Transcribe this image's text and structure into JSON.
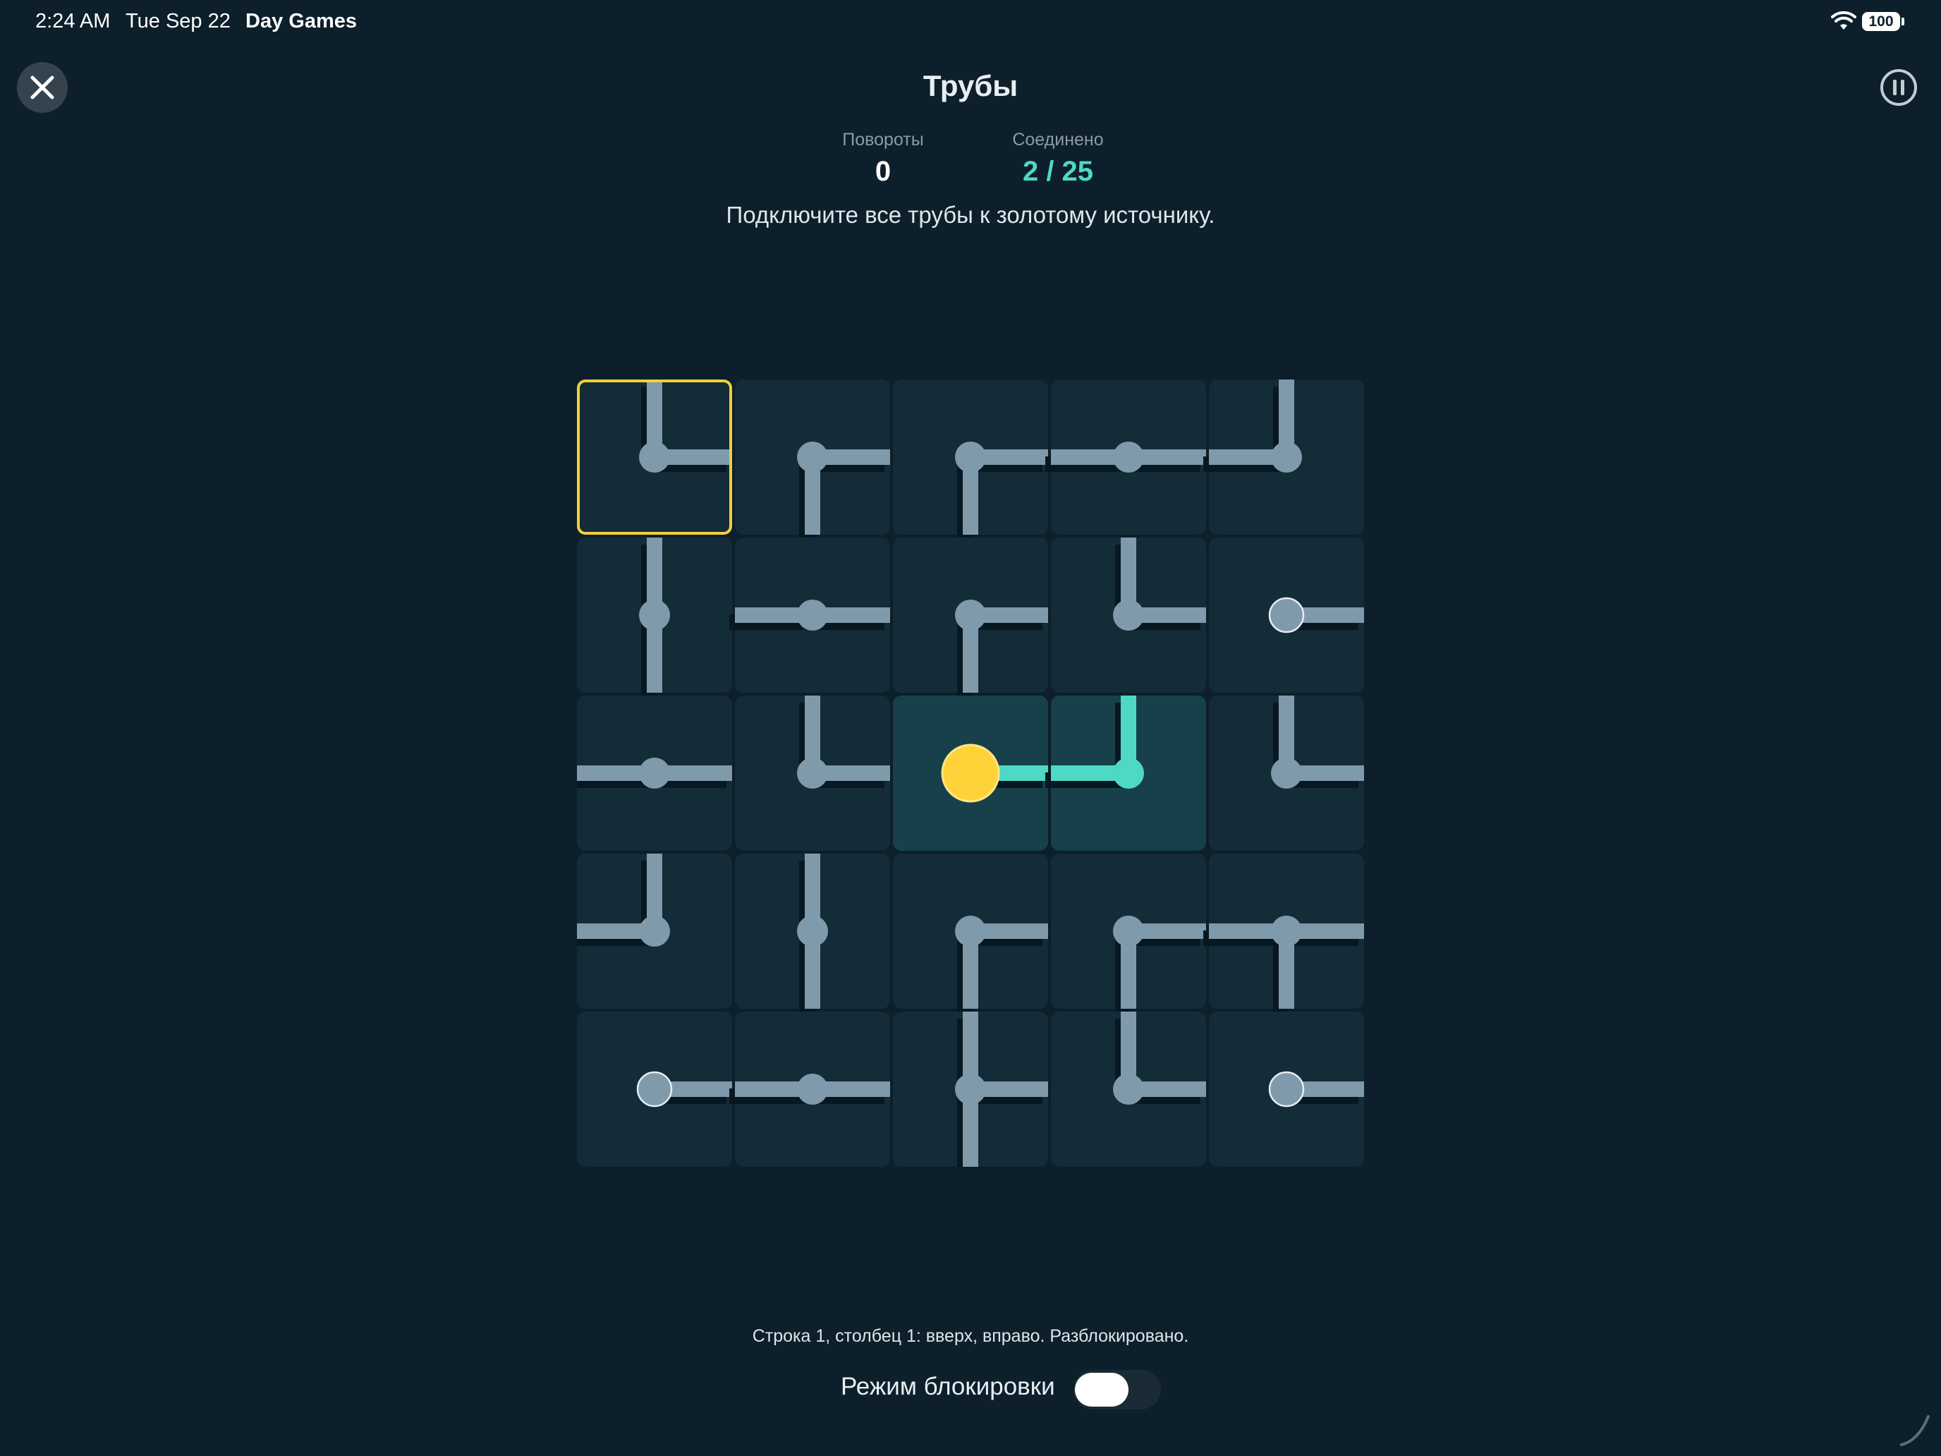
{
  "status_bar": {
    "time": "2:24 AM",
    "date": "Tue Sep 22",
    "app_name": "Day Games",
    "battery": "100"
  },
  "header": {
    "title": "Трубы",
    "close_icon": "close-icon",
    "pause_icon": "pause-icon"
  },
  "stats": {
    "turns_label": "Повороты",
    "turns_value": "0",
    "connected_label": "Соединено",
    "connected_value": "2 / 25"
  },
  "instruction": "Подключите все трубы к золотому источнику.",
  "colors": {
    "background": "#0c1f2a",
    "tile": "#142b38",
    "tile_connected": "#17404b",
    "pipe": "#7f9aab",
    "pipe_connected": "#4fd8c4",
    "source": "#ffd23a",
    "selection": "#f0cf3a"
  },
  "board": {
    "rows": 5,
    "cols": 5,
    "selected": [
      0,
      0
    ],
    "source": [
      2,
      2
    ],
    "tiles": [
      [
        {
          "dirs": [
            "up",
            "right"
          ],
          "connected": false,
          "endpoint": false
        },
        {
          "dirs": [
            "right",
            "down"
          ],
          "connected": false,
          "endpoint": false
        },
        {
          "dirs": [
            "right",
            "down"
          ],
          "connected": false,
          "endpoint": false
        },
        {
          "dirs": [
            "left",
            "right"
          ],
          "connected": false,
          "endpoint": false
        },
        {
          "dirs": [
            "up",
            "left"
          ],
          "connected": false,
          "endpoint": false
        }
      ],
      [
        {
          "dirs": [
            "up",
            "down"
          ],
          "connected": false,
          "endpoint": false
        },
        {
          "dirs": [
            "left",
            "right"
          ],
          "connected": false,
          "endpoint": false
        },
        {
          "dirs": [
            "right",
            "down"
          ],
          "connected": false,
          "endpoint": false
        },
        {
          "dirs": [
            "up",
            "right"
          ],
          "connected": false,
          "endpoint": false
        },
        {
          "dirs": [
            "right"
          ],
          "connected": false,
          "endpoint": true
        }
      ],
      [
        {
          "dirs": [
            "left",
            "right"
          ],
          "connected": false,
          "endpoint": false
        },
        {
          "dirs": [
            "up",
            "right"
          ],
          "connected": false,
          "endpoint": false
        },
        {
          "dirs": [
            "right"
          ],
          "connected": true,
          "endpoint": false
        },
        {
          "dirs": [
            "up",
            "left"
          ],
          "connected": true,
          "endpoint": false
        },
        {
          "dirs": [
            "up",
            "right"
          ],
          "connected": false,
          "endpoint": false
        }
      ],
      [
        {
          "dirs": [
            "up",
            "left"
          ],
          "connected": false,
          "endpoint": false
        },
        {
          "dirs": [
            "up",
            "down"
          ],
          "connected": false,
          "endpoint": false
        },
        {
          "dirs": [
            "right",
            "down"
          ],
          "connected": false,
          "endpoint": false
        },
        {
          "dirs": [
            "right",
            "down"
          ],
          "connected": false,
          "endpoint": false
        },
        {
          "dirs": [
            "left",
            "right",
            "down"
          ],
          "connected": false,
          "endpoint": false
        }
      ],
      [
        {
          "dirs": [
            "right"
          ],
          "connected": false,
          "endpoint": true
        },
        {
          "dirs": [
            "left",
            "right"
          ],
          "connected": false,
          "endpoint": false
        },
        {
          "dirs": [
            "up",
            "right",
            "down"
          ],
          "connected": false,
          "endpoint": false
        },
        {
          "dirs": [
            "up",
            "right"
          ],
          "connected": false,
          "endpoint": false
        },
        {
          "dirs": [
            "right"
          ],
          "connected": false,
          "endpoint": true
        }
      ]
    ]
  },
  "footer": {
    "cell_status": "Строка 1, столбец 1: вверх, вправо. Разблокировано.",
    "lock_mode_label": "Режим блокировки",
    "lock_mode_on": false
  }
}
